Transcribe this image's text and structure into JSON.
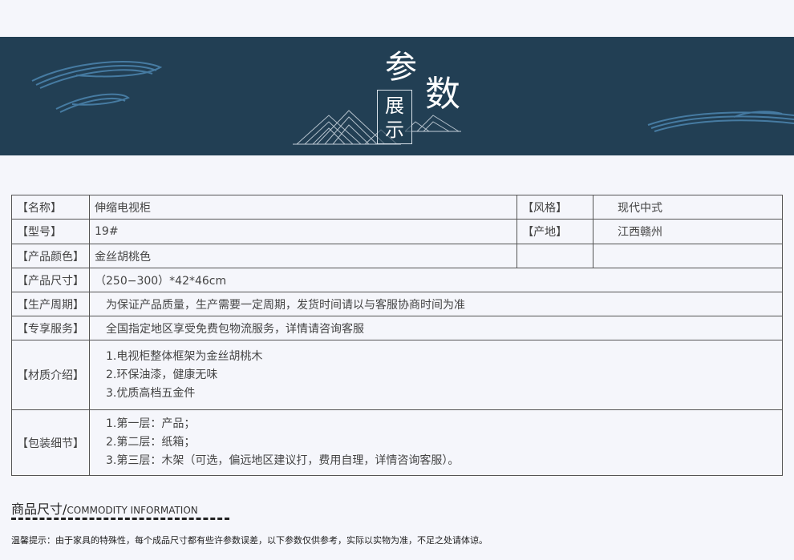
{
  "banner": {
    "title_char_1": "参",
    "title_char_2": "数",
    "title_box_1": "展",
    "title_box_2": "示"
  },
  "params": {
    "name_label": "【名称】",
    "name_value": "伸缩电视柜",
    "style_label": "【风格】",
    "style_value": "现代中式",
    "model_label": "【型号】",
    "model_value": "19#",
    "origin_label": "【产地】",
    "origin_value": "江西赣州",
    "color_label": "【产品颜色】",
    "color_value": "金丝胡桃色",
    "size_label": "【产品尺寸】",
    "size_value": "（250−300）*42*46cm",
    "cycle_label": "【生产周期】",
    "cycle_value": "为保证产品质量，生产需要一定周期，发货时间请以与客服协商时间为准",
    "service_label": "【专享服务】",
    "service_value": "全国指定地区享受免费包物流服务，详情请咨询客服",
    "material_label": "【材质介绍】",
    "material_lines": [
      "1.电视柜整体框架为金丝胡桃木",
      "2.环保油漆，健康无味",
      "3.优质高档五金件"
    ],
    "package_label": "【包装细节】",
    "package_lines": [
      "1.第一层：产品；",
      "2.第二层：纸箱；",
      "3.第三层：木架（可选，偏远地区建议打，费用自理，详情咨询客服）。"
    ]
  },
  "section": {
    "title_cn": "商品尺寸/",
    "title_en": "COMMODITY INFORMATION"
  },
  "note": "温馨提示：由于家具的特殊性，每个成品尺寸都有些许参数误差，以下参数仅供参考，实际以实物为准，不足之处请体谅。",
  "colors": {
    "banner_bg": "#223f54",
    "page_bg": "#f5f6fb"
  }
}
